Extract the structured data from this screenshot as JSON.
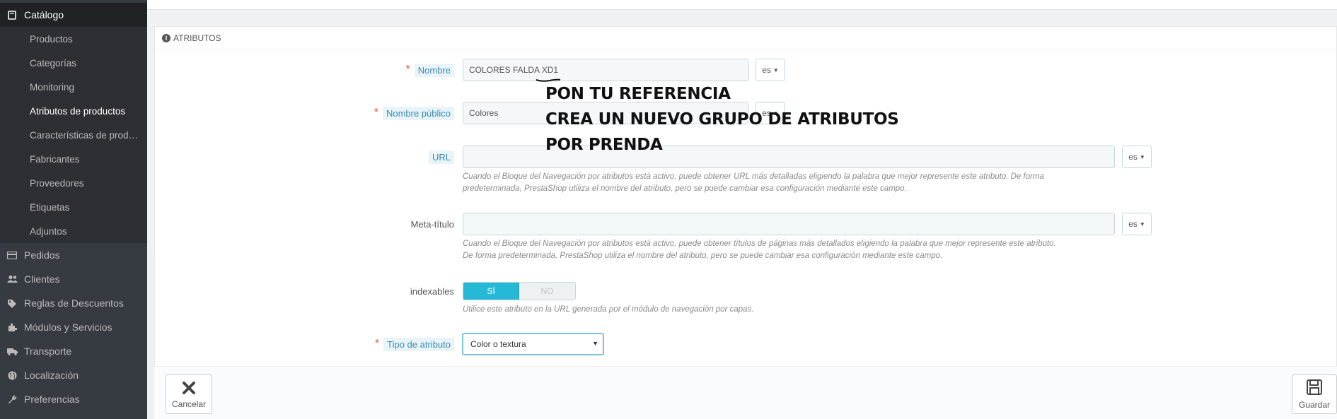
{
  "sidebar": {
    "top": {
      "label": "Catálogo",
      "icon": "book-icon"
    },
    "subitems": [
      {
        "label": "Productos"
      },
      {
        "label": "Categorías"
      },
      {
        "label": "Monitoring"
      },
      {
        "label": "Atributos de productos"
      },
      {
        "label": "Características de productos"
      },
      {
        "label": "Fabricantes"
      },
      {
        "label": "Proveedores"
      },
      {
        "label": "Etiquetas"
      },
      {
        "label": "Adjuntos"
      }
    ],
    "items": [
      {
        "label": "Pedidos",
        "icon": "credit-card-icon"
      },
      {
        "label": "Clientes",
        "icon": "users-icon"
      },
      {
        "label": "Reglas de Descuentos",
        "icon": "tags-icon"
      },
      {
        "label": "Módulos y Servicios",
        "icon": "puzzle-icon"
      },
      {
        "label": "Transporte",
        "icon": "truck-icon"
      },
      {
        "label": "Localización",
        "icon": "globe-icon"
      },
      {
        "label": "Preferencias",
        "icon": "wrench-icon"
      }
    ]
  },
  "panel": {
    "title": "ATRIBUTOS",
    "fields": {
      "nombre": {
        "label": "Nombre",
        "value": "COLORES FALDA XD1",
        "lang": "es"
      },
      "nombre_publico": {
        "label": "Nombre público",
        "value": "Colores",
        "lang": "es"
      },
      "url": {
        "label": "URL",
        "value": "",
        "lang": "es",
        "help_1": "Cuando el Bloque del Navegación por atributos está activo, puede obtener URL más detalladas eligiendo la palabra que mejor represente este atributo. De forma",
        "help_2": "predeterminada, PrestaShop utiliza el nombre del atributo, pero se puede cambiar esa configuración mediante este campo."
      },
      "meta_titulo": {
        "label": "Meta-título",
        "value": "",
        "lang": "es",
        "help_1": "Cuando el Bloque del Navegación por atributos está activo, puede obtener títulos de páginas más detallados eligiendo la palabra que mejor represente este atributo.",
        "help_2": "De forma predeterminada, PrestaShop utiliza el nombre del atributo, pero se puede cambiar esa configuración mediante este campo."
      },
      "indexables": {
        "label": "indexables",
        "on": "SÍ",
        "off": "NO",
        "help": "Utilice este atributo en la URL generada por el módulo de navegación por capas."
      },
      "tipo": {
        "label": "Tipo de atributo",
        "value": "Color o textura"
      }
    }
  },
  "footer": {
    "cancel": "Cancelar",
    "save": "Guardar"
  },
  "annotation": {
    "line1": "PON TU REFERENCIA",
    "line2": "CREA UN NUEVO GRUPO DE ATRIBUTOS",
    "line3": "POR PRENDA"
  }
}
